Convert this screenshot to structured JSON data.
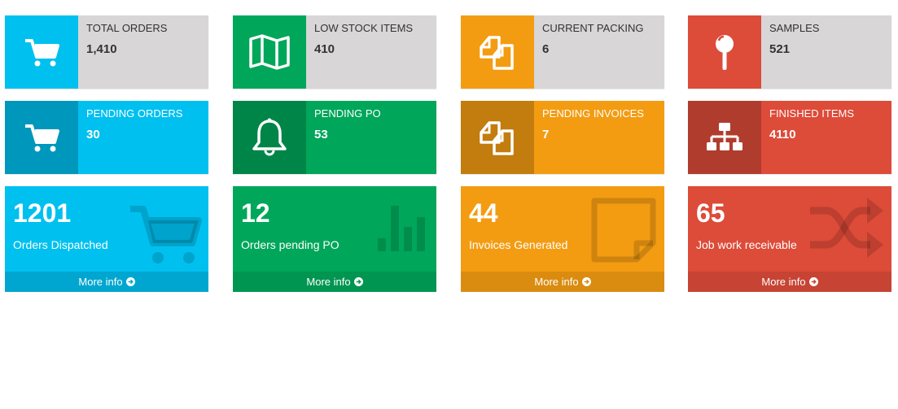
{
  "colors": {
    "aqua": "#00c0ef",
    "aqua_dark": "#0097bc",
    "green": "#00a65a",
    "green_dark": "#008548",
    "orange": "#f39c12",
    "orange_dark": "#c27d0e",
    "red": "#dd4b39",
    "red_dark": "#b03c2d",
    "grey": "#d8d6d6"
  },
  "chart_data": {
    "type": "table",
    "info_boxes": [
      {
        "label": "TOTAL ORDERS",
        "value": "1,410",
        "icon": "shopping-cart-icon"
      },
      {
        "label": "LOW STOCK ITEMS",
        "value": "410",
        "icon": "map-icon"
      },
      {
        "label": "CURRENT PACKING",
        "value": "6",
        "icon": "files-icon"
      },
      {
        "label": "SAMPLES",
        "value": "521",
        "icon": "map-pin-icon"
      },
      {
        "label": "PENDING ORDERS",
        "value": "30",
        "icon": "shopping-cart-icon"
      },
      {
        "label": "PENDING PO",
        "value": "53",
        "icon": "bell-icon"
      },
      {
        "label": "PENDING INVOICES",
        "value": "7",
        "icon": "files-icon"
      },
      {
        "label": "FINISHED ITEMS",
        "value": "4110",
        "icon": "sitemap-icon"
      }
    ],
    "small_boxes": [
      {
        "value": "1201",
        "label": "Orders Dispatched",
        "icon": "shopping-cart-icon"
      },
      {
        "value": "12",
        "label": "Orders pending PO",
        "icon": "bar-chart-icon"
      },
      {
        "value": "44",
        "label": "Invoices Generated",
        "icon": "sticky-note-icon"
      },
      {
        "value": "65",
        "label": "Job work receivable",
        "icon": "random-icon"
      }
    ]
  },
  "footer_label": "More info"
}
